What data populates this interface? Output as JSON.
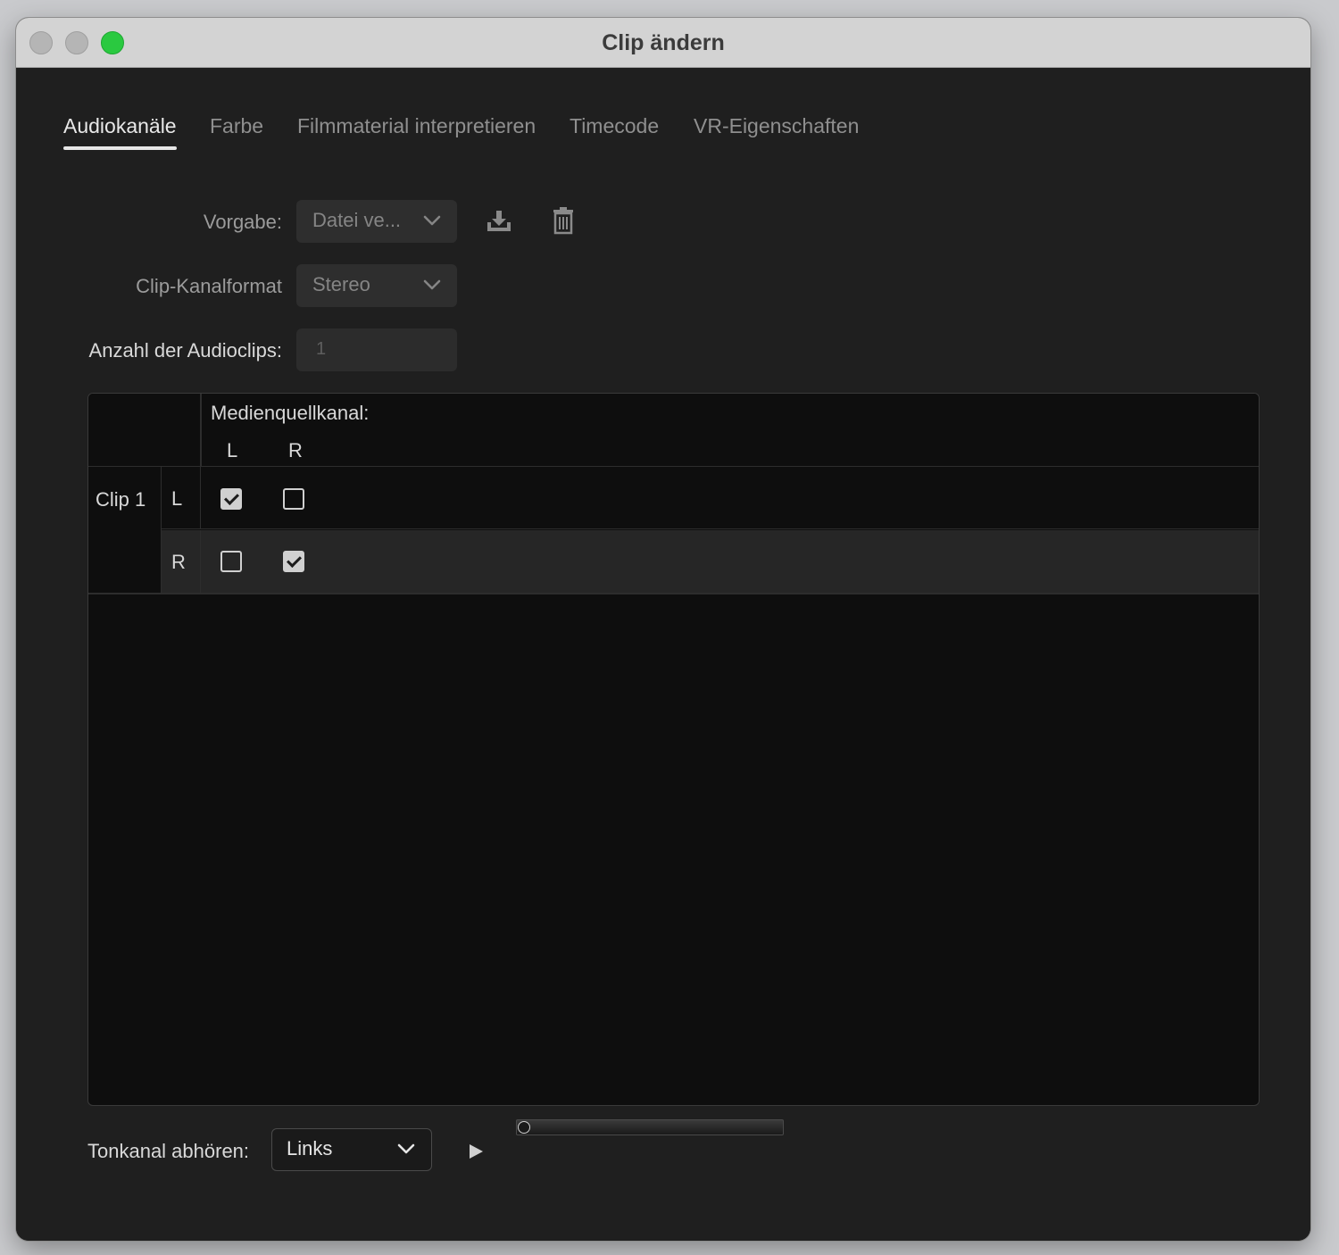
{
  "window": {
    "title": "Clip ändern"
  },
  "tabs": [
    {
      "label": "Audiokanäle",
      "active": true
    },
    {
      "label": "Farbe",
      "active": false
    },
    {
      "label": "Filmmaterial interpretieren",
      "active": false
    },
    {
      "label": "Timecode",
      "active": false
    },
    {
      "label": "VR-Eigenschaften",
      "active": false
    }
  ],
  "form": {
    "preset_label": "Vorgabe:",
    "preset_value": "Datei ve...",
    "save_preset_icon": "download-icon",
    "delete_preset_icon": "trash-icon",
    "channel_format_label": "Clip-Kanalformat",
    "channel_format_value": "Stereo",
    "audio_clips_label": "Anzahl der Audioclips:",
    "audio_clips_value": "1"
  },
  "grid": {
    "header_title": "Medienquellkanal:",
    "source_channels": [
      "L",
      "R"
    ],
    "clips": [
      {
        "label": "Clip 1",
        "channels": [
          {
            "label": "L",
            "checks": [
              true,
              false
            ]
          },
          {
            "label": "R",
            "checks": [
              false,
              true
            ]
          }
        ]
      }
    ]
  },
  "monitor": {
    "label": "Tonkanal abhören:",
    "value": "Links",
    "play_icon": "play-icon",
    "level": 0
  },
  "colors": {
    "background": "#1f1f1f",
    "grid_bg": "#0e0e0e",
    "titlebar": "#d3d3d3",
    "zoom_button": "#2ac940"
  }
}
